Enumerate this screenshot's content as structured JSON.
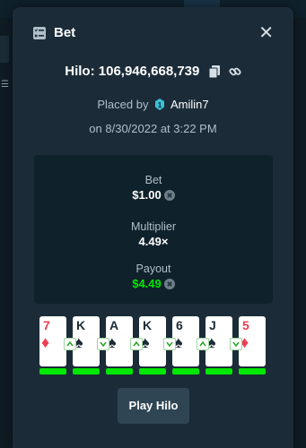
{
  "modal": {
    "title": "Bet",
    "game_label": "Hilo: 106,946,668,739",
    "placed_by_prefix": "Placed by",
    "username": "Amilin7",
    "date": "on 8/30/2022 at 3:22 PM"
  },
  "stats": {
    "bet_label": "Bet",
    "bet_value": "$1.00",
    "multiplier_label": "Multiplier",
    "multiplier_value": "4.49×",
    "payout_label": "Payout",
    "payout_value": "$4.49"
  },
  "cards": [
    {
      "rank": "7",
      "suit": "diamonds",
      "color": "red"
    },
    {
      "rank": "K",
      "suit": "spades",
      "color": "black"
    },
    {
      "rank": "A",
      "suit": "spades",
      "color": "black"
    },
    {
      "rank": "K",
      "suit": "spades",
      "color": "black"
    },
    {
      "rank": "6",
      "suit": "spades",
      "color": "black"
    },
    {
      "rank": "J",
      "suit": "spades",
      "color": "black"
    },
    {
      "rank": "5",
      "suit": "diamonds",
      "color": "red"
    }
  ],
  "guesses": [
    "higher",
    "lower",
    "higher",
    "lower",
    "higher",
    "lower"
  ],
  "play_button": "Play Hilo",
  "colors": {
    "accent_green": "#00e701",
    "red_suit": "#f03d52",
    "modal_bg": "#1b2c38",
    "panel_bg": "#0f212b"
  },
  "icons": {
    "header": "bet-list-icon",
    "copy": "copy-icon",
    "link": "link-icon",
    "close": "close-icon",
    "user": "vip-star-icon",
    "currency": "currency-coin-icon"
  }
}
